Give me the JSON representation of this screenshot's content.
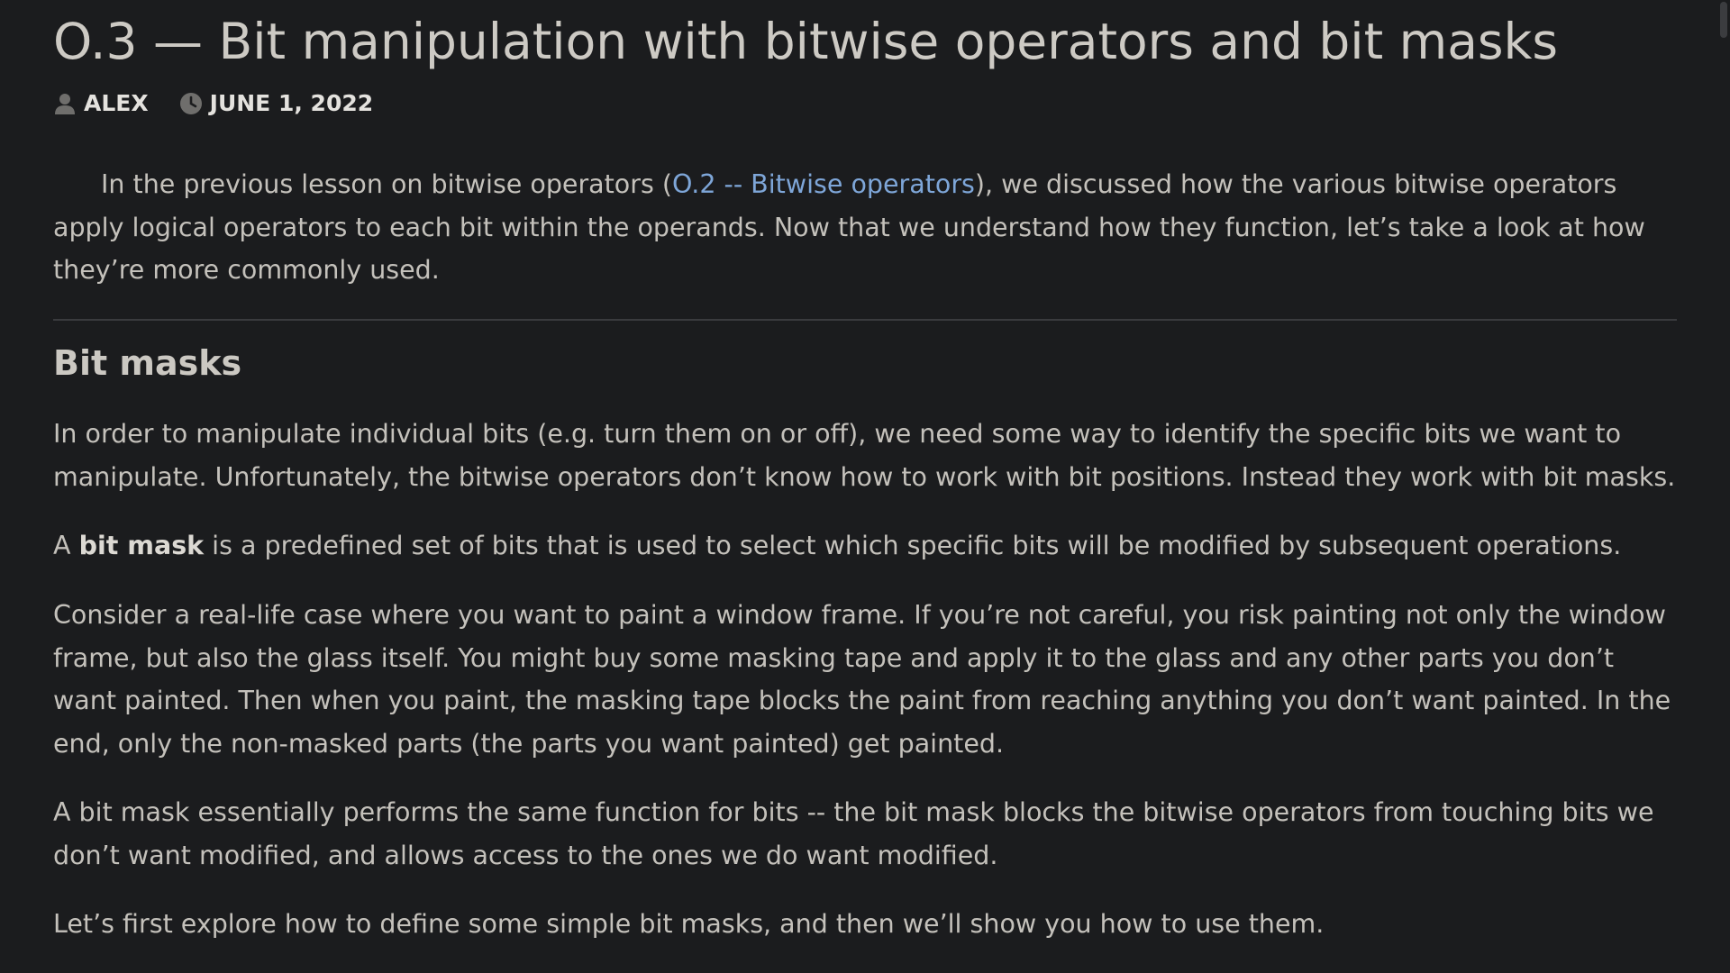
{
  "article": {
    "title": "O.3 — Bit manipulation with bitwise operators and bit masks",
    "author": "ALEX",
    "date": "JUNE 1, 2022",
    "author_icon": "user-icon",
    "date_icon": "clock-icon"
  },
  "intro": {
    "before_link": "In the previous lesson on bitwise operators (",
    "link_text": "O.2 -- Bitwise operators",
    "after_link": "), we discussed how the various bitwise operators apply logical operators to each bit within the operands. Now that we understand how they function, let’s take a look at how they’re more commonly used."
  },
  "section": {
    "heading": "Bit masks",
    "p1": "In order to manipulate individual bits (e.g. turn them on or off), we need some way to identify the specific bits we want to manipulate. Unfortunately, the bitwise operators don’t know how to work with bit positions. Instead they work with bit masks.",
    "p2_before": "A ",
    "p2_bold": "bit mask",
    "p2_after": " is a predefined set of bits that is used to select which specific bits will be modified by subsequent operations.",
    "p3": "Consider a real-life case where you want to paint a window frame. If you’re not careful, you risk painting not only the window frame, but also the glass itself. You might buy some masking tape and apply it to the glass and any other parts you don’t want painted. Then when you paint, the masking tape blocks the paint from reaching anything you don’t want painted. In the end, only the non-masked parts (the parts you want painted) get painted.",
    "p4": "A bit mask essentially performs the same function for bits -- the bit mask blocks the bitwise operators from touching bits we don’t want modified, and allows access to the ones we do want modified.",
    "p5": "Let’s first explore how to define some simple bit masks, and then we’ll show you how to use them."
  },
  "colors": {
    "background": "#1b1c1e",
    "text": "#c4c1bb",
    "link": "#7ea6d8"
  }
}
